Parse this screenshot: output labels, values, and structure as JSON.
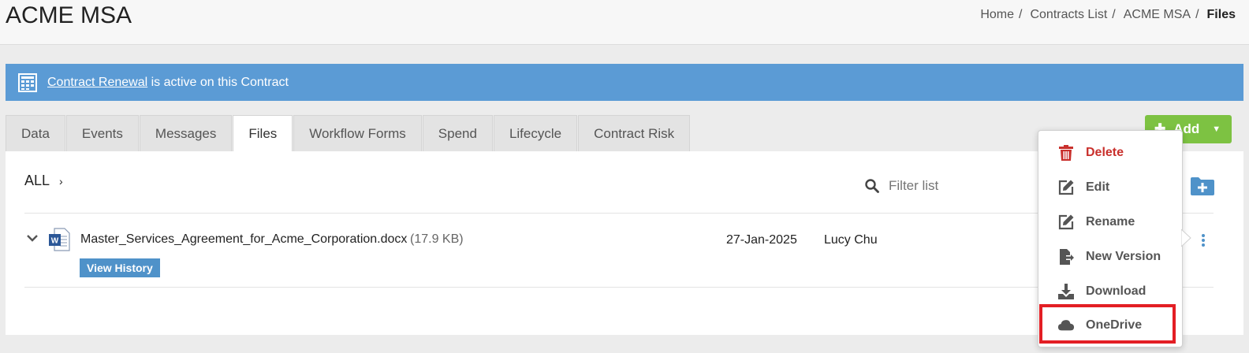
{
  "header": {
    "title": "ACME MSA",
    "breadcrumb": [
      "Home",
      "Contracts List",
      "ACME MSA",
      "Files"
    ]
  },
  "alert": {
    "link_text": "Contract Renewal",
    "message": " is active on this Contract",
    "icon": "table-icon",
    "color": "#5b9bd5"
  },
  "tabs": [
    "Data",
    "Events",
    "Messages",
    "Files",
    "Workflow Forms",
    "Spend",
    "Lifecycle",
    "Contract Risk"
  ],
  "active_tab": "Files",
  "add_button": {
    "label": "Add",
    "color": "#7dc242"
  },
  "files_panel": {
    "scope_label": "ALL",
    "filter_placeholder": "Filter list",
    "file": {
      "name": "Master_Services_Agreement_for_Acme_Corporation.docx",
      "size": "(17.9 KB)",
      "date": "27-Jan-2025",
      "owner": "Lucy Chu",
      "history_label": "View History"
    }
  },
  "context_menu": {
    "items": [
      {
        "label": "Delete",
        "icon": "trash-icon"
      },
      {
        "label": "Edit",
        "icon": "edit-icon"
      },
      {
        "label": "Rename",
        "icon": "edit-icon"
      },
      {
        "label": "New Version",
        "icon": "file-import-icon"
      },
      {
        "label": "Download",
        "icon": "download-icon"
      },
      {
        "label": "OneDrive",
        "icon": "cloud-icon"
      }
    ],
    "danger_color": "#c9302c",
    "highlight_color": "#e31e24"
  }
}
